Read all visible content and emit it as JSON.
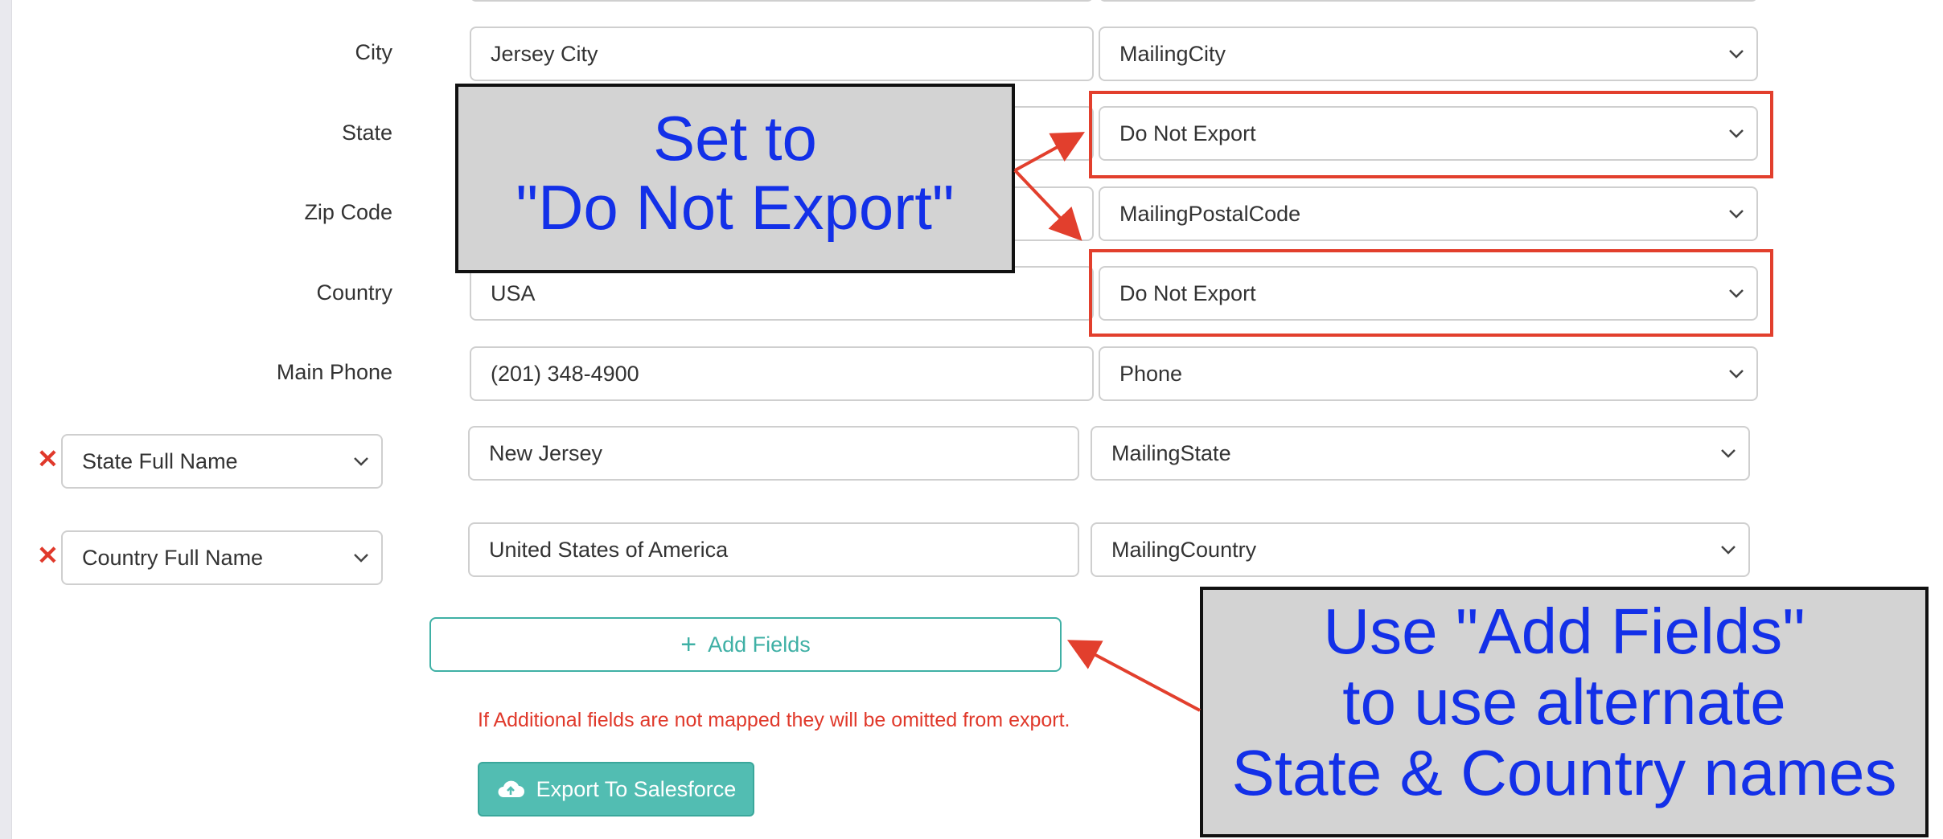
{
  "rows": {
    "city": {
      "label": "City",
      "value": "Jersey City",
      "field": "MailingCity"
    },
    "state": {
      "label": "State",
      "field": "Do Not Export"
    },
    "zip": {
      "label": "Zip Code",
      "field": "MailingPostalCode"
    },
    "country": {
      "label": "Country",
      "value": "USA",
      "field": "Do Not Export"
    },
    "phone": {
      "label": "Main Phone",
      "value": "(201) 348-4900",
      "field": "Phone"
    }
  },
  "extra_fields": [
    {
      "source": "State Full Name",
      "value": "New Jersey",
      "field": "MailingState"
    },
    {
      "source": "Country Full Name",
      "value": "United States of America",
      "field": "MailingCountry"
    }
  ],
  "buttons": {
    "add_fields": "Add Fields",
    "export": "Export To Salesforce"
  },
  "note": "If Additional fields are not mapped they will be omitted from export.",
  "callouts": {
    "set_to": [
      "Set to",
      "\"Do Not Export\""
    ],
    "add_fields": [
      "Use \"Add Fields\"",
      "to use alternate",
      "State & Country names"
    ]
  },
  "colors": {
    "accent": "#52bdb2",
    "highlight": "#e23f2d",
    "callout_text": "#1330e8",
    "error": "#e0392b"
  },
  "icons": [
    "chevron-down-icon",
    "remove-x-icon",
    "plus-icon",
    "cloud-upload-icon",
    "arrow-icon"
  ]
}
